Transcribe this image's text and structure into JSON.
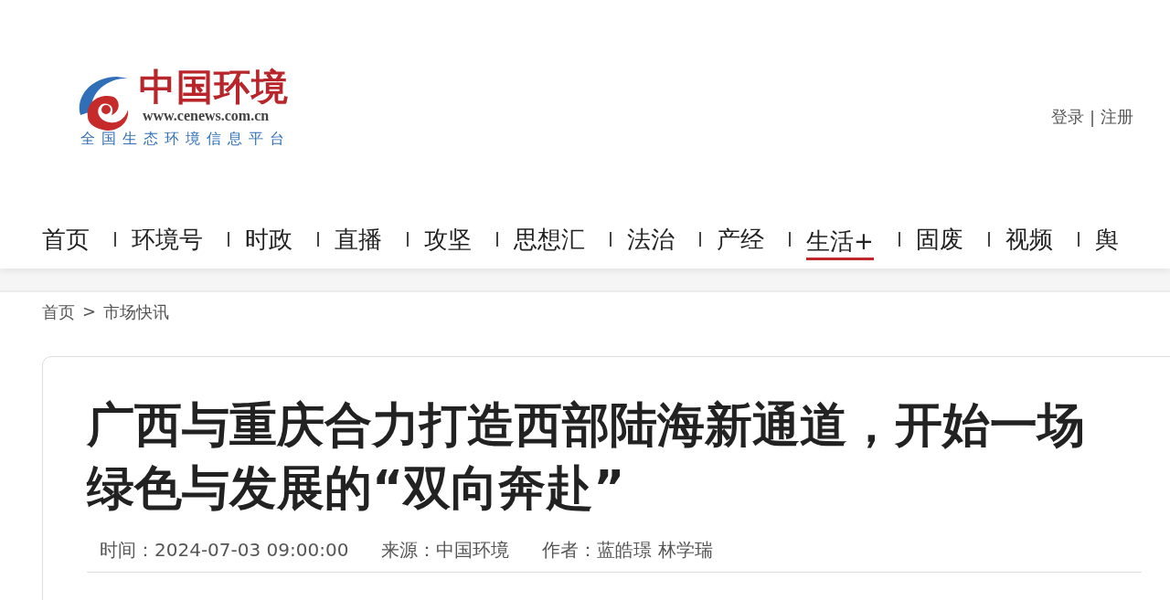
{
  "logo": {
    "name": "中国环境",
    "url": "www.cenews.com.cn",
    "slogan": "全国生态环境信息平台"
  },
  "account": {
    "login": "登录",
    "separator": "|",
    "register": "注册"
  },
  "nav": [
    {
      "label": "首页",
      "selected": false
    },
    {
      "label": "环境号",
      "selected": false
    },
    {
      "label": "时政",
      "selected": false
    },
    {
      "label": "直播",
      "selected": false
    },
    {
      "label": "攻坚",
      "selected": false
    },
    {
      "label": "思想汇",
      "selected": false
    },
    {
      "label": "法治",
      "selected": false
    },
    {
      "label": "产经",
      "selected": false
    },
    {
      "label": "生活+",
      "selected": true
    },
    {
      "label": "固废",
      "selected": false
    },
    {
      "label": "视频",
      "selected": false
    },
    {
      "label": "舆",
      "selected": false
    }
  ],
  "breadcrumb": {
    "items": [
      "首页",
      "市场快讯"
    ],
    "separator": ">"
  },
  "article": {
    "title": "广西与重庆合力打造西部陆海新通道，开始一场绿色与发展的“双向奔赴”",
    "meta": [
      {
        "label": "时间：",
        "value": "2024-07-03 09:00:00"
      },
      {
        "label": "来源：",
        "value": "中国环境"
      },
      {
        "label": "作者：",
        "value": "蓝皓璟 林学瑞"
      }
    ]
  }
}
